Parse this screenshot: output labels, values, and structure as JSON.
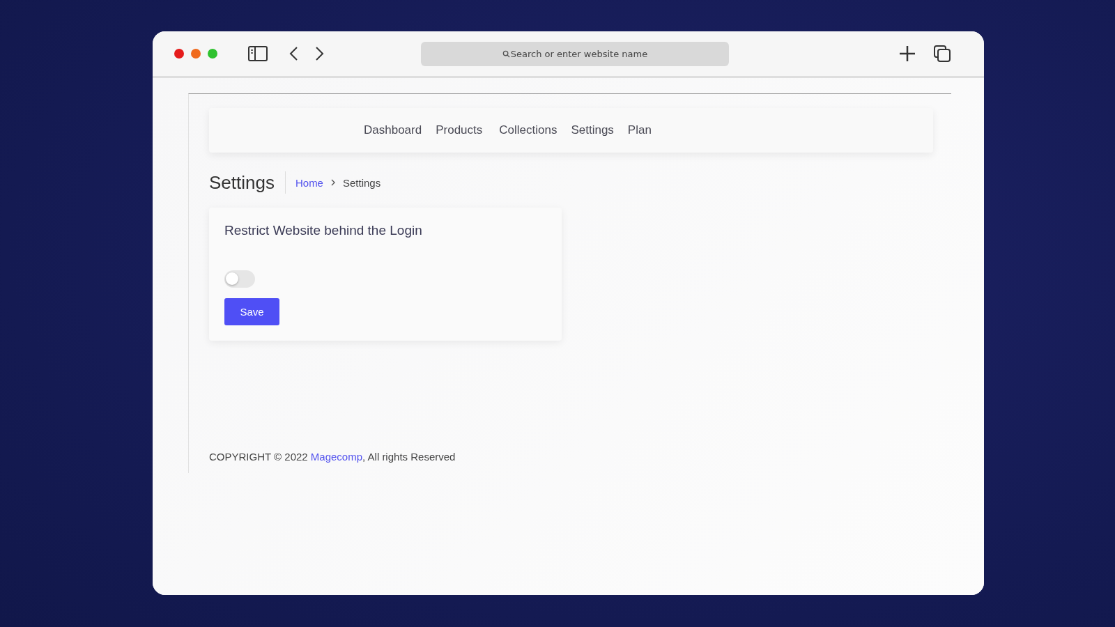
{
  "browser": {
    "address_placeholder": "Search or enter website name"
  },
  "nav": {
    "items": [
      "Dashboard",
      "Products",
      "Collections",
      "Settings",
      "Plan"
    ]
  },
  "page": {
    "title": "Settings",
    "breadcrumb": [
      {
        "label": "Home",
        "link": true
      },
      {
        "label": "Settings",
        "link": false
      }
    ]
  },
  "card": {
    "title": "Restrict Website behind the Login",
    "toggle": {
      "on": false
    },
    "button": "Save"
  },
  "footer": {
    "before": "COPYRIGHT © 2022 ",
    "link": "Magecomp",
    "after": ", All rights Reserved"
  }
}
